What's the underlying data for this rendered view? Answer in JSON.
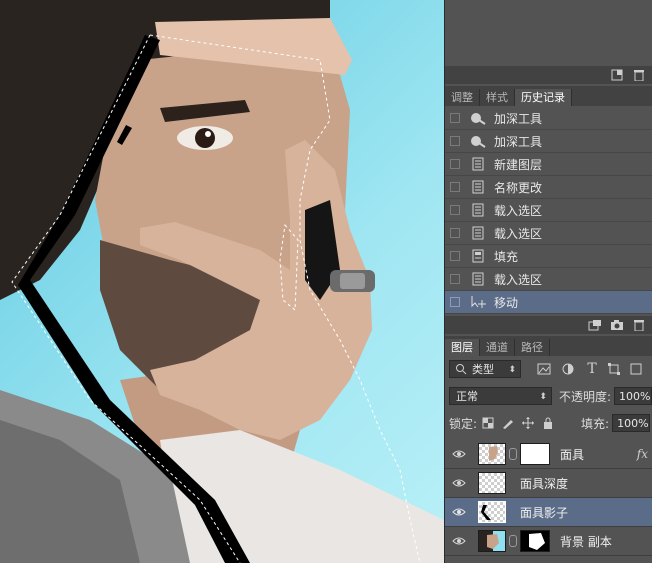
{
  "panels": {
    "history_tabs": [
      {
        "label": "调整",
        "active": false
      },
      {
        "label": "样式",
        "active": false
      },
      {
        "label": "历史记录",
        "active": true
      }
    ],
    "history_items": [
      {
        "label": "加深工具",
        "icon": "burn-tool-icon",
        "selected": false
      },
      {
        "label": "加深工具",
        "icon": "burn-tool-icon",
        "selected": false
      },
      {
        "label": "新建图层",
        "icon": "document-icon",
        "selected": false
      },
      {
        "label": "名称更改",
        "icon": "document-icon",
        "selected": false
      },
      {
        "label": "载入选区",
        "icon": "document-icon",
        "selected": false
      },
      {
        "label": "载入选区",
        "icon": "document-icon",
        "selected": false
      },
      {
        "label": "填充",
        "icon": "fill-icon",
        "selected": false
      },
      {
        "label": "载入选区",
        "icon": "document-icon",
        "selected": false
      },
      {
        "label": "移动",
        "icon": "move-tool-icon",
        "selected": true
      }
    ],
    "layers_tabs": [
      {
        "label": "图层",
        "active": true
      },
      {
        "label": "通道",
        "active": false
      },
      {
        "label": "路径",
        "active": false
      }
    ],
    "filter_kind": "类型",
    "blend_mode": "正常",
    "opacity_label": "不透明度:",
    "opacity_value": "100%",
    "lock_label": "锁定:",
    "fill_label": "填充:",
    "fill_value": "100%",
    "layers": [
      {
        "name": "面具",
        "visible": true,
        "selected": false,
        "has_mask": true,
        "has_fx": true,
        "fx_label": "fx"
      },
      {
        "name": "面具深度",
        "visible": true,
        "selected": false,
        "has_mask": false,
        "has_fx": false
      },
      {
        "name": "面具影子",
        "visible": true,
        "selected": true,
        "has_mask": false,
        "has_fx": false
      },
      {
        "name": "背景 副本",
        "visible": true,
        "selected": false,
        "has_mask": true,
        "has_fx": false
      }
    ]
  },
  "colors": {
    "panel_bg": "#535353",
    "selected_row": "#5b6c88",
    "canvas_bg": "#8fe0f0"
  }
}
